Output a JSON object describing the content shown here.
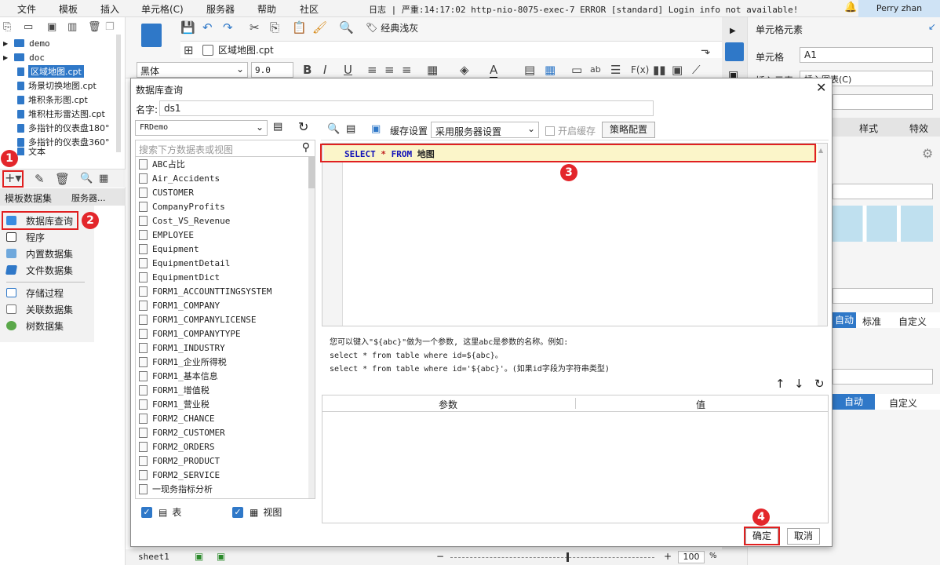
{
  "menubar": {
    "items": [
      "文件",
      "模板",
      "插入",
      "单元格(C)",
      "服务器",
      "帮助",
      "社区"
    ],
    "log": "日志 | 严重:14:17:02 http-nio-8075-exec-7 ERROR [standard] Login info not available!",
    "user": "Perry zhan"
  },
  "tree": {
    "items": [
      "demo",
      "doc",
      "区域地图.cpt",
      "场景切换地图.cpt",
      "堆积条形图.cpt",
      "堆积柱形雷达图.cpt",
      "多指针的仪表盘180°",
      "多指针的仪表盘360°",
      "文本"
    ]
  },
  "left_tabs": {
    "template": "模板数据集",
    "server": "服务器..."
  },
  "ds_menu": {
    "items": [
      "数据库查询",
      "程序",
      "内置数据集",
      "文件数据集",
      "存储过程",
      "关联数据集",
      "树数据集"
    ]
  },
  "editor": {
    "tab": "区域地图.cpt",
    "theme": "经典浅灰",
    "font": "黑体",
    "size": "9.0"
  },
  "right": {
    "title": "单元格元素",
    "cell_label": "单元格",
    "cell_value": "A1",
    "insert_label": "插入元素",
    "insert_value": "插入图表(C)",
    "tab_style": "样式",
    "tab_special": "特效",
    "std": "标准",
    "custom": "自定义",
    "auto": "自动",
    "auto2": "自动",
    "custom2": "自定义",
    "sheet": "sheet1",
    "zoom": "100"
  },
  "dialog": {
    "title": "数据库查询",
    "name_label": "名字:",
    "name_value": "ds1",
    "db": "FRDemo",
    "search_placeholder": "搜索下方数据表或视图",
    "cache_label": "缓存设置",
    "cache_value": "采用服务器设置",
    "cache_toggle": "开启缓存",
    "strategy": "策略配置",
    "sql": {
      "line": "1",
      "select": "SELECT",
      "star": "*",
      "from": "FROM",
      "table": "地图"
    },
    "tip1": "您可以键入\"${abc}\"做为一个参数, 这里abc是参数的名称。例如:",
    "tip2": "select * from table where id=${abc}。",
    "tip3": "select * from table where id='${abc}'。(如果id字段为字符串类型)",
    "col_param": "参数",
    "col_value": "值",
    "chk_table": "表",
    "chk_view": "视图",
    "ok": "确定",
    "cancel": "取消",
    "tables": [
      "ABC占比",
      "Air_Accidents",
      "CUSTOMER",
      "CompanyProfits",
      "Cost_VS_Revenue",
      "EMPLOYEE",
      "Equipment",
      "EquipmentDetail",
      "EquipmentDict",
      "FORM1_ACCOUNTTINGSYSTEM",
      "FORM1_COMPANY",
      "FORM1_COMPANYLICENSE",
      "FORM1_COMPANYTYPE",
      "FORM1_INDUSTRY",
      "FORM1_企业所得税",
      "FORM1_基本信息",
      "FORM1_增值税",
      "FORM1_营业税",
      "FORM2_CHANCE",
      "FORM2_CUSTOMER",
      "FORM2_ORDERS",
      "FORM2_PRODUCT",
      "FORM2_SERVICE",
      "一现务指标分析"
    ]
  },
  "badges": [
    "1",
    "2",
    "3",
    "4"
  ],
  "colors": {
    "accent": "#2f78c8",
    "highlight": "#e02020",
    "badge": "#e3262b"
  }
}
